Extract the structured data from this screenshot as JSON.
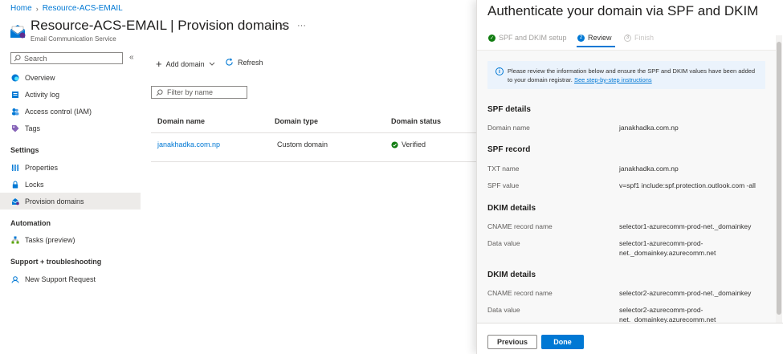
{
  "breadcrumb": {
    "home": "Home",
    "resource": "Resource-ACS-EMAIL"
  },
  "header": {
    "title": "Resource-ACS-EMAIL | Provision domains",
    "subtitle": "Email Communication Service"
  },
  "sidebar": {
    "search_placeholder": "Search",
    "items": [
      {
        "label": "Overview",
        "icon": "overview-icon"
      },
      {
        "label": "Activity log",
        "icon": "activity-log-icon"
      },
      {
        "label": "Access control (IAM)",
        "icon": "people-icon"
      },
      {
        "label": "Tags",
        "icon": "tag-icon"
      }
    ],
    "sections": [
      {
        "title": "Settings",
        "items": [
          {
            "label": "Properties",
            "icon": "properties-icon"
          },
          {
            "label": "Locks",
            "icon": "lock-icon"
          },
          {
            "label": "Provision domains",
            "icon": "domain-icon",
            "active": true
          }
        ]
      },
      {
        "title": "Automation",
        "items": [
          {
            "label": "Tasks (preview)",
            "icon": "tasks-icon"
          }
        ]
      },
      {
        "title": "Support + troubleshooting",
        "items": [
          {
            "label": "New Support Request",
            "icon": "support-icon"
          }
        ]
      }
    ]
  },
  "toolbar": {
    "add_domain": "Add domain",
    "refresh": "Refresh"
  },
  "filter": {
    "placeholder": "Filter by name"
  },
  "table": {
    "headers": [
      "Domain name",
      "Domain type",
      "Domain status"
    ],
    "rows": [
      {
        "domain": "janakhadka.com.np",
        "type": "Custom domain",
        "status": "Verified"
      }
    ]
  },
  "panel": {
    "title": "Authenticate your domain via SPF and DKIM",
    "steps": [
      {
        "label": "SPF and DKIM setup",
        "state": "done"
      },
      {
        "label": "Review",
        "state": "current",
        "number": "2"
      },
      {
        "label": "Finish",
        "state": "pending",
        "number": "3"
      }
    ],
    "info": {
      "text": "Please review the information below and ensure the SPF and DKIM values have been added to your domain registrar.",
      "link": "See step-by-step instructions"
    },
    "spf_details": {
      "heading": "SPF details",
      "domain_label": "Domain name",
      "domain_value": "janakhadka.com.np"
    },
    "spf_record": {
      "heading": "SPF record",
      "txt_label": "TXT name",
      "txt_value": "janakhadka.com.np",
      "spf_label": "SPF value",
      "spf_value": "v=spf1 include:spf.protection.outlook.com -all"
    },
    "dkim1": {
      "heading": "DKIM details",
      "cname_label": "CNAME record name",
      "cname_value": "selector1-azurecomm-prod-net._domainkey",
      "data_label": "Data value",
      "data_value_1": "selector1-azurecomm-prod-",
      "data_value_2": "net._domainkey.azurecomm.net"
    },
    "dkim2": {
      "heading": "DKIM details",
      "cname_label": "CNAME record name",
      "cname_value": "selector2-azurecomm-prod-net._domainkey",
      "data_label": "Data value",
      "data_value_1": "selector2-azurecomm-prod-",
      "data_value_2": "net._domainkey.azurecomm.net"
    },
    "buttons": {
      "previous": "Previous",
      "done": "Done"
    }
  },
  "colors": {
    "accent": "#0078d4",
    "success": "#107c10"
  }
}
